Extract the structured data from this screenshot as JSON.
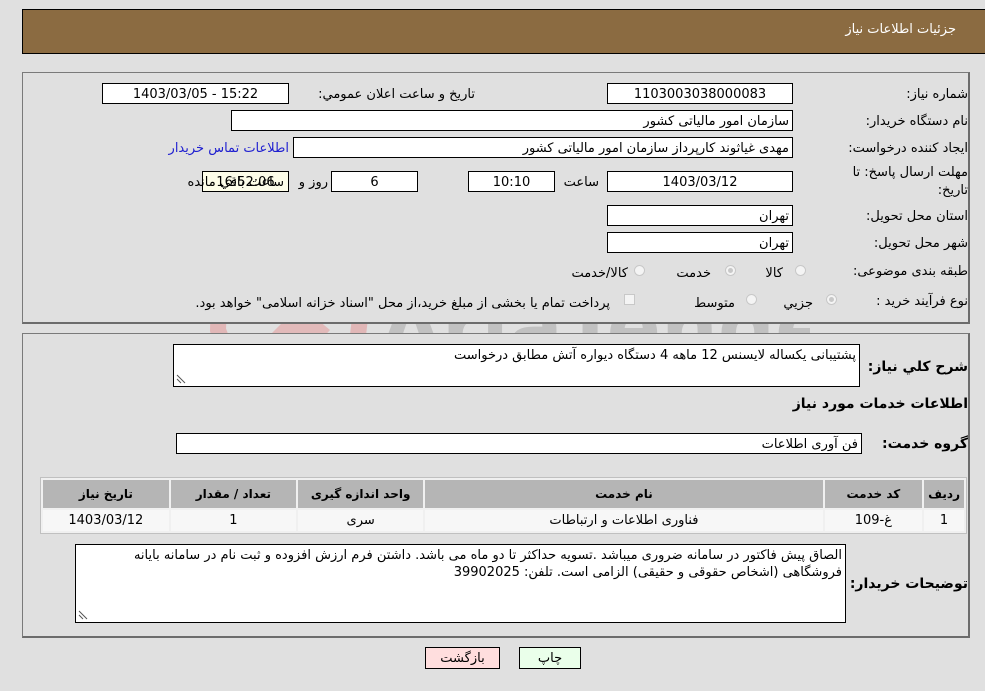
{
  "header": {
    "title": "جزئیات اطلاعات نیاز"
  },
  "form": {
    "need_number": {
      "label": "شماره نیاز:",
      "value": "1103003038000083"
    },
    "announce_datetime": {
      "label": "تاریخ و ساعت اعلان عمومي:",
      "value": "1403/03/05 - 15:22"
    },
    "buyer_org": {
      "label": "نام دستگاه خريدار:",
      "value": "سازمان امور مالیاتی کشور"
    },
    "requester": {
      "label": "ایجاد کننده درخواست:",
      "value": "مهدی غیاثوند کارپرداز سازمان امور مالیاتی کشور"
    },
    "buyer_contact_link": "اطلاعات تماس خریدار",
    "deadline": {
      "label": "مهلت ارسال پاسخ: تا تاریخ:",
      "date": "1403/03/12",
      "time_label": "ساعت",
      "time": "10:10",
      "days": "6",
      "days_label": "روز و",
      "remaining": "16:52:06",
      "remaining_label": "ساعت باقي مانده"
    },
    "delivery_province": {
      "label": "استان محل تحویل:",
      "value": "تهران"
    },
    "delivery_city": {
      "label": "شهر محل تحویل:",
      "value": "تهران"
    },
    "category": {
      "label": "طبقه بندی موضوعی:",
      "options": [
        {
          "label": "کالا",
          "selected": false
        },
        {
          "label": "خدمت",
          "selected": true
        },
        {
          "label": "کالا/خدمت",
          "selected": false
        }
      ]
    },
    "purchase_type": {
      "label": "نوع فرآیند خرید :",
      "options": [
        {
          "label": "جزيي",
          "selected": true
        },
        {
          "label": "متوسط",
          "selected": false
        }
      ],
      "treasury_note": "پرداخت تمام یا بخشی از مبلغ خرید،از محل \"اسناد خزانه اسلامی\" خواهد بود.",
      "treasury_checked": false
    }
  },
  "description": {
    "label": "شرح کلي نياز:",
    "value": "پشتیبانی یکساله لایسنس 12 ماهه 4 دستگاه دیواره آتش مطابق درخواست"
  },
  "services_section": {
    "title": "اطلاعات خدمات مورد نياز",
    "service_group": {
      "label": "گروه خدمت:",
      "value": "فن آوری اطلاعات"
    },
    "table": {
      "columns": [
        "ردیف",
        "کد خدمت",
        "نام خدمت",
        "واحد اندازه گیری",
        "تعداد / مقدار",
        "تاریخ نیاز"
      ],
      "rows": [
        [
          "1",
          "غ-109",
          "فناوری اطلاعات و ارتباطات",
          "سری",
          "1",
          "1403/03/12"
        ]
      ]
    }
  },
  "buyer_notes": {
    "label": "توضیحات خریدار:",
    "value": "الصاق پیش فاکتور در سامانه ضروری میباشد .تسویه حداکثر تا دو ماه می باشد.  داشتن فرم ارزش افزوده و ثبت نام در سامانه بایانه فروشگاهی (اشخاص حقوقی و حقیقی) الزامی است. تلفن:  39902025"
  },
  "buttons": {
    "print": "چاپ",
    "back": "بازگشت"
  },
  "watermark": "AriaTender.neT",
  "colors": {
    "header_bg": "#8b6b41",
    "link": "#2020d0",
    "print_bg": "#eaffea",
    "back_bg": "#ffdede"
  }
}
